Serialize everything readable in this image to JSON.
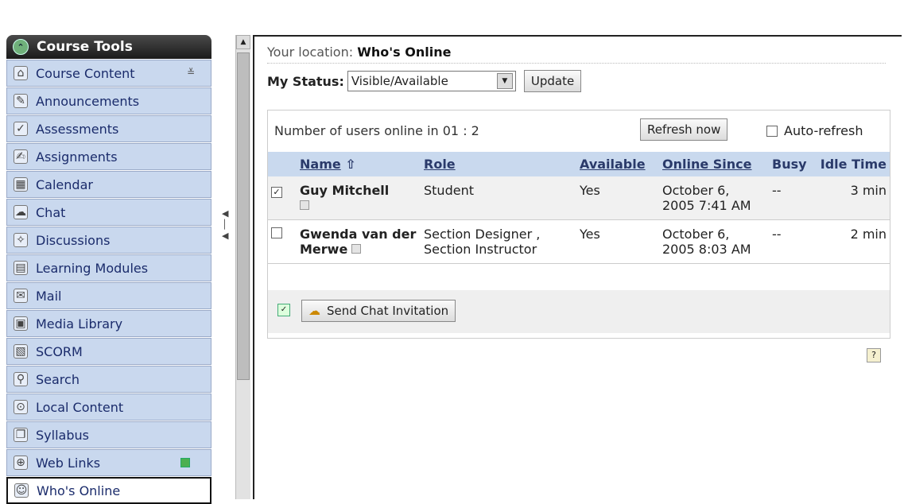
{
  "sidebar": {
    "header": {
      "label": "Course Tools",
      "icon": "collapse-icon"
    },
    "items": [
      {
        "label": "Course Content",
        "icon": "course-content-icon"
      },
      {
        "label": "Announcements",
        "icon": "announcements-icon"
      },
      {
        "label": "Assessments",
        "icon": "assessments-icon"
      },
      {
        "label": "Assignments",
        "icon": "assignments-icon"
      },
      {
        "label": "Calendar",
        "icon": "calendar-icon"
      },
      {
        "label": "Chat",
        "icon": "chat-icon"
      },
      {
        "label": "Discussions",
        "icon": "discussions-icon"
      },
      {
        "label": "Learning Modules",
        "icon": "learning-modules-icon"
      },
      {
        "label": "Mail",
        "icon": "mail-icon"
      },
      {
        "label": "Media Library",
        "icon": "media-library-icon"
      },
      {
        "label": "SCORM",
        "icon": "scorm-icon"
      },
      {
        "label": "Search",
        "icon": "search-icon"
      },
      {
        "label": "Local Content",
        "icon": "local-content-icon"
      },
      {
        "label": "Syllabus",
        "icon": "syllabus-icon"
      },
      {
        "label": "Web Links",
        "icon": "web-links-icon"
      },
      {
        "label": "Who's Online",
        "icon": "whos-online-icon"
      }
    ]
  },
  "location": {
    "prefix": "Your location:",
    "page": "Who's Online"
  },
  "status": {
    "label": "My Status:",
    "value": "Visible/Available",
    "update_label": "Update"
  },
  "panel": {
    "count_text": "Number of users online in 01 : 2",
    "refresh_label": "Refresh now",
    "autorefresh_label": "Auto-refresh"
  },
  "table": {
    "headers": {
      "name": "Name",
      "role": "Role",
      "available": "Available",
      "online_since": "Online Since",
      "busy": "Busy",
      "idle": "Idle Time"
    },
    "rows": [
      {
        "name": "Guy Mitchell",
        "role": "Student",
        "available": "Yes",
        "online_since": "October 6, 2005 7:41 AM",
        "busy": "--",
        "idle": "3 min",
        "checked": true
      },
      {
        "name": "Gwenda van der Merwe",
        "role": "Section Designer , Section Instructor",
        "available": "Yes",
        "online_since": "October 6, 2005 8:03 AM",
        "busy": "--",
        "idle": "2 min",
        "checked": false
      }
    ]
  },
  "send_chat_label": "Send Chat Invitation",
  "colors": {
    "sidebar_item_bg": "#c9d8ee",
    "header_bg": "#2b2b2b",
    "table_header_bg": "#c9d9ee"
  }
}
